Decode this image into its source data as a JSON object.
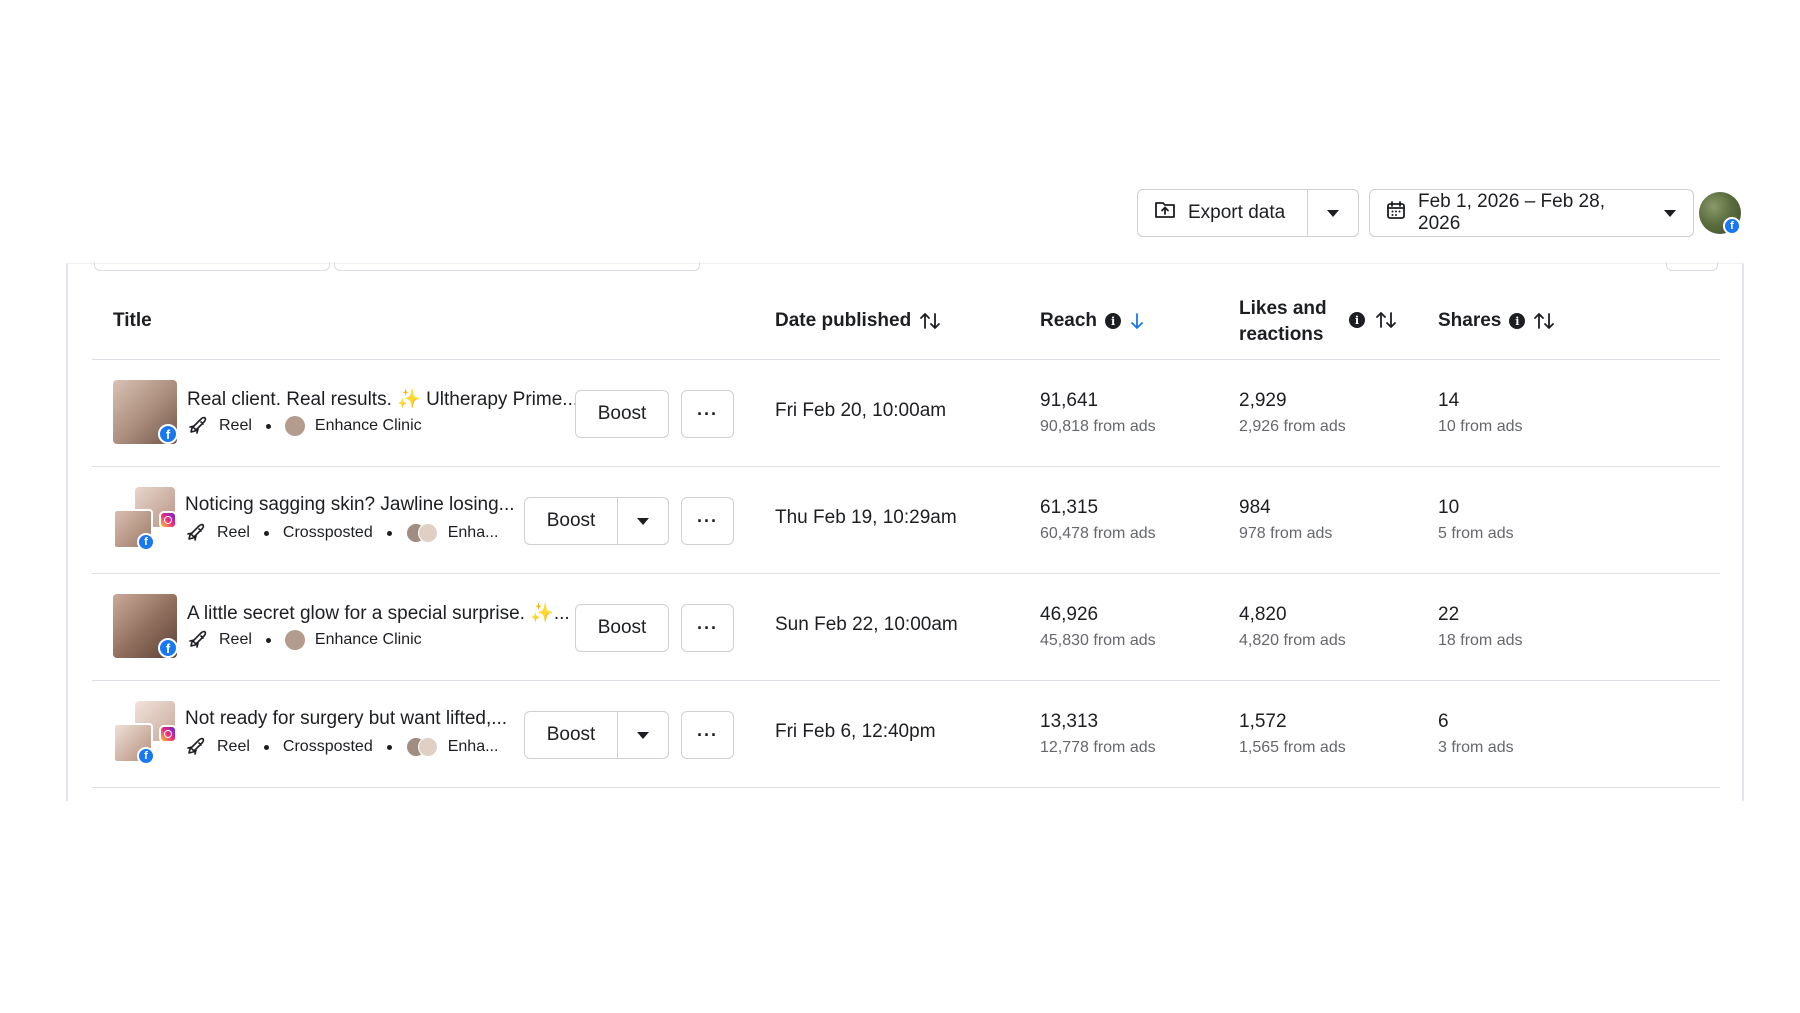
{
  "toolbar": {
    "export_label": "Export data",
    "date_range": "Feb 1, 2026 – Feb 28, 2026"
  },
  "table": {
    "headers": {
      "title": "Title",
      "date_published": "Date published",
      "reach": "Reach",
      "likes": "Likes and reactions",
      "shares": "Shares"
    },
    "rows": [
      {
        "title": "Real client. Real results. ✨ Ultherapy Prime...",
        "type": "Reel",
        "crossposted": "",
        "page": "Enhance Clinic",
        "boost_label": "Boost",
        "date": "Fri Feb 20, 10:00am",
        "reach": "91,641",
        "reach_ads": "90,818 from ads",
        "likes": "2,929",
        "likes_ads": "2,926 from ads",
        "shares": "14",
        "shares_ads": "10 from ads"
      },
      {
        "title": "Noticing sagging skin? Jawline losing...",
        "type": "Reel",
        "crossposted": "Crossposted",
        "page": "Enha...",
        "boost_label": "Boost",
        "date": "Thu Feb 19, 10:29am",
        "reach": "61,315",
        "reach_ads": "60,478 from ads",
        "likes": "984",
        "likes_ads": "978 from ads",
        "shares": "10",
        "shares_ads": "5 from ads"
      },
      {
        "title": "A little secret glow for a special surprise. ✨...",
        "type": "Reel",
        "crossposted": "",
        "page": "Enhance Clinic",
        "boost_label": "Boost",
        "date": "Sun Feb 22, 10:00am",
        "reach": "46,926",
        "reach_ads": "45,830 from ads",
        "likes": "4,820",
        "likes_ads": "4,820 from ads",
        "shares": "22",
        "shares_ads": "18 from ads"
      },
      {
        "title": "Not ready for surgery but want lifted,...",
        "type": "Reel",
        "crossposted": "Crossposted",
        "page": "Enha...",
        "boost_label": "Boost",
        "date": "Fri Feb 6, 12:40pm",
        "reach": "13,313",
        "reach_ads": "12,778 from ads",
        "likes": "1,572",
        "likes_ads": "1,565 from ads",
        "shares": "6",
        "shares_ads": "3 from ads"
      }
    ]
  },
  "colors": {
    "facebook_blue": "#1877f2",
    "sort_active": "#1877f2",
    "border": "#ced0d4",
    "muted_text": "#65676b"
  }
}
